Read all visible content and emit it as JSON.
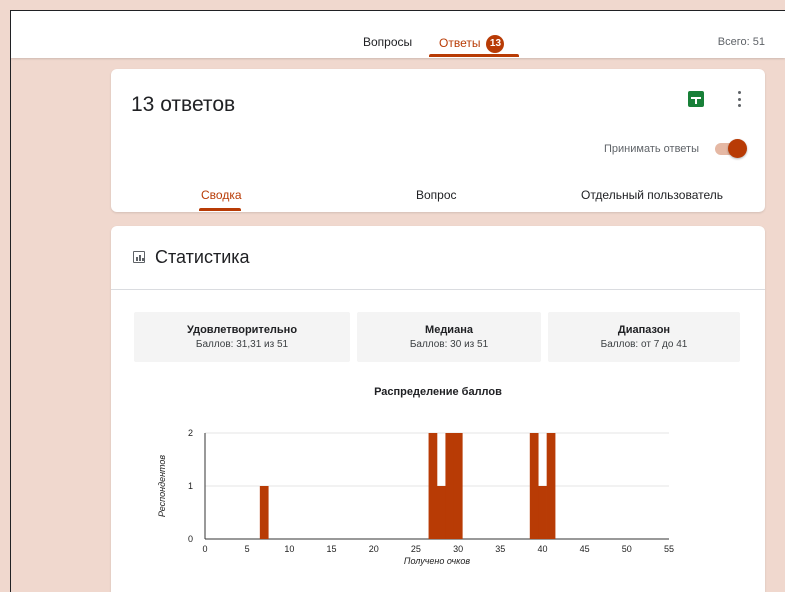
{
  "topbar": {
    "tab_questions": "Вопросы",
    "tab_responses": "Ответы",
    "responses_badge": "13",
    "total": "Всего: 51"
  },
  "responses_card": {
    "title": "13 ответов",
    "accept_label": "Принимать ответы",
    "accepting": true,
    "sheets_icon": "sheets-icon",
    "more_icon": "more-vert-icon",
    "subtabs": [
      "Сводка",
      "Вопрос",
      "Отдельный пользователь"
    ]
  },
  "stats_card": {
    "title": "Статистика",
    "icon": "bar-chart-icon",
    "boxes": [
      {
        "title": "Удовлетворительно",
        "value": "Баллов: 31,31 из 51"
      },
      {
        "title": "Медиана",
        "value": "Баллов: 30 из 51"
      },
      {
        "title": "Диапазон",
        "value": "Баллов: от 7 до 41"
      }
    ]
  },
  "colors": {
    "accent": "#b83b05",
    "background": "#f0d8ce",
    "sheets": "#188038"
  },
  "chart_data": {
    "type": "bar",
    "title": "Распределение баллов",
    "xlabel": "Получено очков",
    "ylabel": "Респондентов",
    "xlim": [
      0,
      55
    ],
    "ylim": [
      0,
      2
    ],
    "xticks": [
      0,
      5,
      10,
      15,
      20,
      25,
      30,
      35,
      40,
      45,
      50,
      55
    ],
    "yticks": [
      0,
      1,
      2
    ],
    "grid": true,
    "x": [
      7,
      27,
      28,
      29,
      30,
      39,
      40,
      41
    ],
    "values": [
      1,
      2,
      1,
      2,
      2,
      2,
      1,
      2
    ]
  }
}
